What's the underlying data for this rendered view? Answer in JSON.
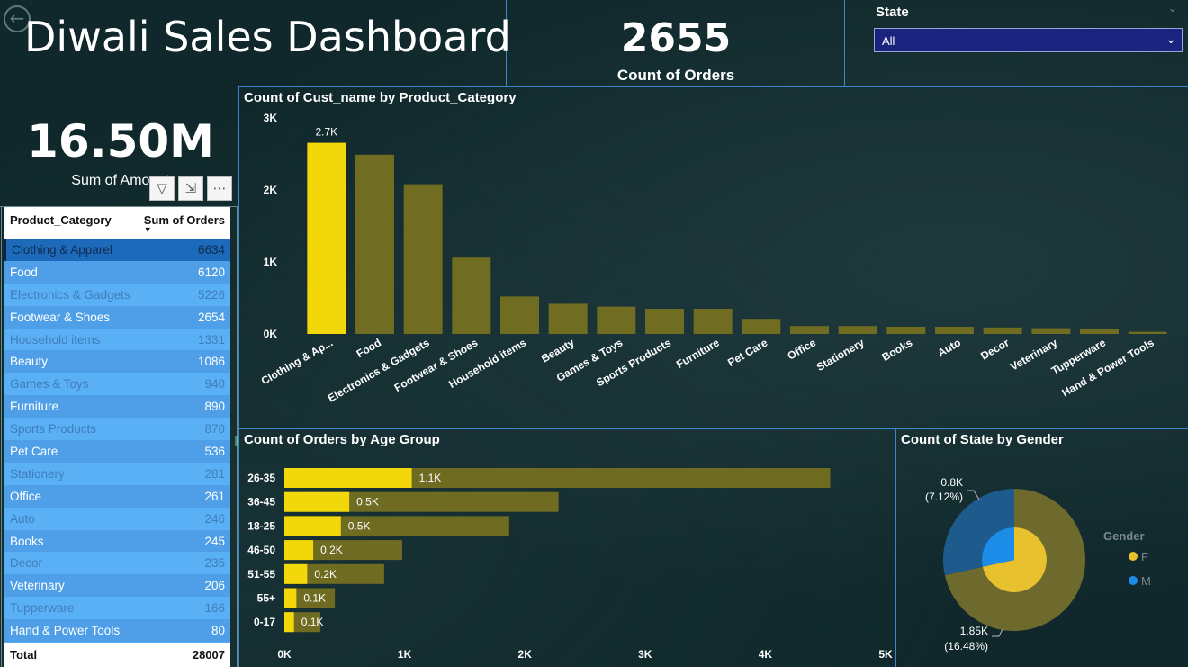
{
  "header": {
    "title": "Diwali Sales Dashboard",
    "back_icon": "arrow-left-circle-icon"
  },
  "kpi_orders": {
    "value": "2655",
    "label": "Count of Orders"
  },
  "kpi_amount": {
    "value": "16.50M",
    "label": "Sum of Amount"
  },
  "state_slicer": {
    "label": "State",
    "value": "All"
  },
  "visual_tools": [
    "filter-icon",
    "focus-mode-icon",
    "more-options-icon"
  ],
  "table": {
    "headers": [
      "Product_Category",
      "Sum of Orders"
    ],
    "rows": [
      {
        "category": "Clothing & Apparel",
        "orders": "6634"
      },
      {
        "category": "Food",
        "orders": "6120"
      },
      {
        "category": "Electronics & Gadgets",
        "orders": "5226"
      },
      {
        "category": "Footwear & Shoes",
        "orders": "2654"
      },
      {
        "category": "Household items",
        "orders": "1331"
      },
      {
        "category": "Beauty",
        "orders": "1086"
      },
      {
        "category": "Games & Toys",
        "orders": "940"
      },
      {
        "category": "Furniture",
        "orders": "890"
      },
      {
        "category": "Sports Products",
        "orders": "870"
      },
      {
        "category": "Pet Care",
        "orders": "536"
      },
      {
        "category": "Stationery",
        "orders": "281"
      },
      {
        "category": "Office",
        "orders": "261"
      },
      {
        "category": "Auto",
        "orders": "246"
      },
      {
        "category": "Books",
        "orders": "245"
      },
      {
        "category": "Decor",
        "orders": "235"
      },
      {
        "category": "Veterinary",
        "orders": "206"
      },
      {
        "category": "Tupperware",
        "orders": "166"
      },
      {
        "category": "Hand & Power Tools",
        "orders": "80"
      }
    ],
    "total_label": "Total",
    "total_value": "28007"
  },
  "chart_data": [
    {
      "type": "bar",
      "title": "Count of Cust_name by Product_Category",
      "categories": [
        "Clothing & Ap...",
        "Food",
        "Electronics & Gadgets",
        "Footwear & Shoes",
        "Household items",
        "Beauty",
        "Games & Toys",
        "Sports Products",
        "Furniture",
        "Pet Care",
        "Office",
        "Stationery",
        "Books",
        "Auto",
        "Decor",
        "Veterinary",
        "Tupperware",
        "Hand & Power Tools"
      ],
      "values": [
        2655,
        2490,
        2080,
        1060,
        520,
        420,
        380,
        350,
        350,
        210,
        110,
        110,
        100,
        100,
        90,
        80,
        70,
        30
      ],
      "ylim": [
        0,
        3000
      ],
      "yticks": [
        "0K",
        "1K",
        "2K",
        "3K"
      ],
      "data_labels": [
        "2.7K"
      ],
      "highlight_color": "#f2d80a",
      "base_color": "#706c22"
    },
    {
      "type": "bar",
      "orientation": "horizontal",
      "title": "Count of Orders by Age Group",
      "categories": [
        "26-35",
        "36-45",
        "18-25",
        "46-50",
        "51-55",
        "55+",
        "0-17"
      ],
      "series": [
        {
          "values": [
            1060,
            540,
            470,
            240,
            190,
            100,
            80
          ]
        },
        {
          "values": [
            4540,
            2280,
            1870,
            980,
            830,
            420,
            300
          ]
        }
      ],
      "data_labels": [
        "1.1K",
        "0.5K",
        "0.5K",
        "0.2K",
        "0.2K",
        "0.1K",
        "0.1K"
      ],
      "xlim": [
        0,
        5000
      ],
      "xticks": [
        "0K",
        "1K",
        "2K",
        "3K",
        "4K",
        "5K"
      ]
    },
    {
      "type": "pie",
      "title": "Count of State by Gender",
      "legend_title": "Gender",
      "slices": [
        {
          "label": "F",
          "share": 0.7152,
          "color": "#e8c12f"
        },
        {
          "label": "M",
          "share": 0.2848,
          "color": "#1c8ce8"
        }
      ],
      "annotations": [
        {
          "value": "0.8K",
          "percent": "(7.12%)"
        },
        {
          "value": "1.85K",
          "percent": "(16.48%)"
        }
      ]
    }
  ]
}
